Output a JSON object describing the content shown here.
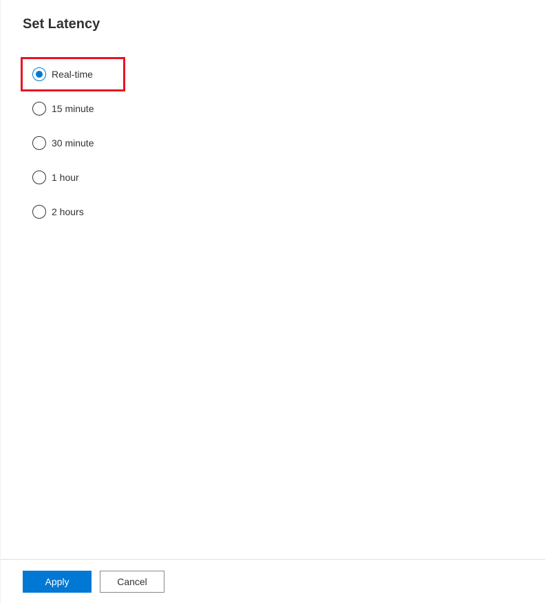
{
  "title": "Set Latency",
  "options": [
    {
      "label": "Real-time",
      "selected": true,
      "highlighted": true
    },
    {
      "label": "15 minute",
      "selected": false,
      "highlighted": false
    },
    {
      "label": "30 minute",
      "selected": false,
      "highlighted": false
    },
    {
      "label": "1 hour",
      "selected": false,
      "highlighted": false
    },
    {
      "label": "2 hours",
      "selected": false,
      "highlighted": false
    }
  ],
  "buttons": {
    "apply": "Apply",
    "cancel": "Cancel"
  },
  "colors": {
    "accent": "#0078d4",
    "highlight_border": "#e81123"
  }
}
